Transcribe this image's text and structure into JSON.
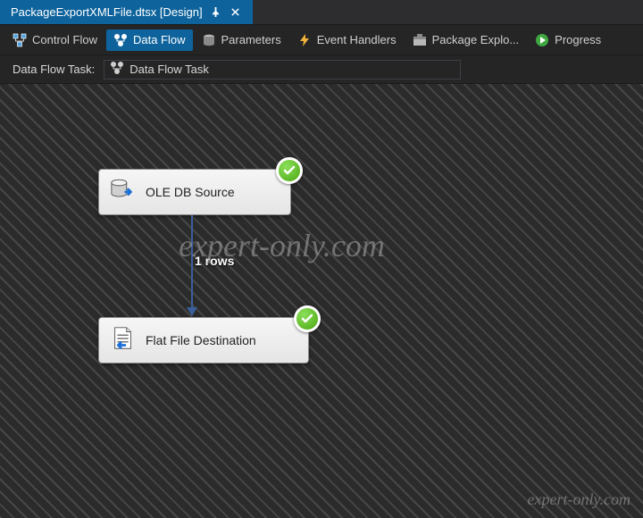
{
  "documentTab": {
    "title": "PackageExportXMLFile.dtsx [Design]"
  },
  "ssisTabs": {
    "items": [
      {
        "label": "Control Flow"
      },
      {
        "label": "Data Flow"
      },
      {
        "label": "Parameters"
      },
      {
        "label": "Event Handlers"
      },
      {
        "label": "Package Explo..."
      },
      {
        "label": "Progress"
      }
    ],
    "selectedIndex": 1
  },
  "taskbar": {
    "label": "Data Flow Task:",
    "currentTask": "Data Flow Task"
  },
  "canvas": {
    "source": {
      "label": "OLE DB Source",
      "status": "success"
    },
    "destination": {
      "label": "Flat File Destination",
      "status": "success"
    },
    "connector": {
      "rowCountLabel": "1 rows"
    }
  },
  "watermark": {
    "main": "expert-only.com",
    "corner": "expert-only.com"
  }
}
